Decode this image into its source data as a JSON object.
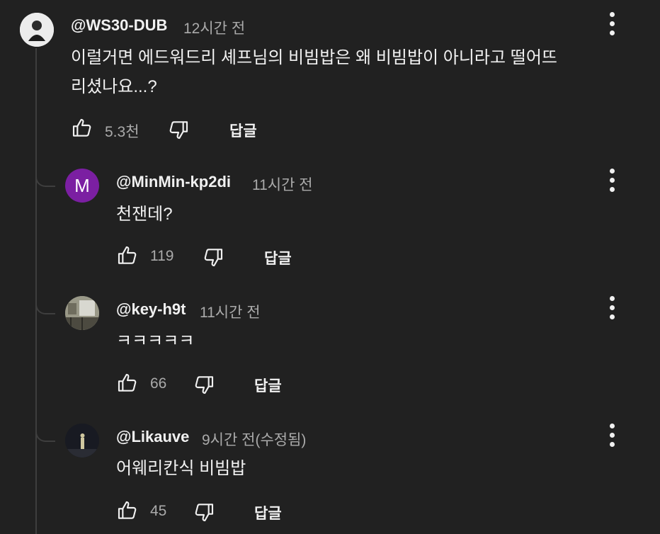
{
  "comment": {
    "handle": "@WS30-DUB",
    "time": "12시간 전",
    "text_line1": "이럴거면 에드워드리 셰프님의 비빔밥은 왜 비빔밥이 아니라고 떨어뜨",
    "text_line2": "리셨나요...?",
    "likes": "5.3천",
    "reply_label": "답글",
    "avatar_icon": "profile-photo-icon"
  },
  "replies": [
    {
      "handle": "@MinMin-kp2di",
      "time": "11시간 전",
      "text": "천잰데?",
      "likes": "119",
      "reply_label": "답글",
      "avatar_letter": "M",
      "avatar_color": "#7b1fa2"
    },
    {
      "handle": "@key-h9t",
      "time": "11시간 전",
      "text": "ㅋㅋㅋㅋㅋ",
      "likes": "66",
      "reply_label": "답글",
      "avatar_icon": "profile-photo-icon"
    },
    {
      "handle": "@Likauve",
      "time": "9시간 전(수정됨)",
      "text": "어웨리칸식 비빔밥",
      "likes": "45",
      "reply_label": "답글",
      "avatar_icon": "profile-photo-icon"
    }
  ],
  "icons": {
    "like": "thumbs-up-icon",
    "dislike": "thumbs-down-icon",
    "menu": "more-vertical-icon"
  },
  "colors": {
    "background": "#212121",
    "text": "#f1f1f1",
    "secondary_text": "#aaaaaa",
    "thread_line": "#3e3e3e"
  }
}
